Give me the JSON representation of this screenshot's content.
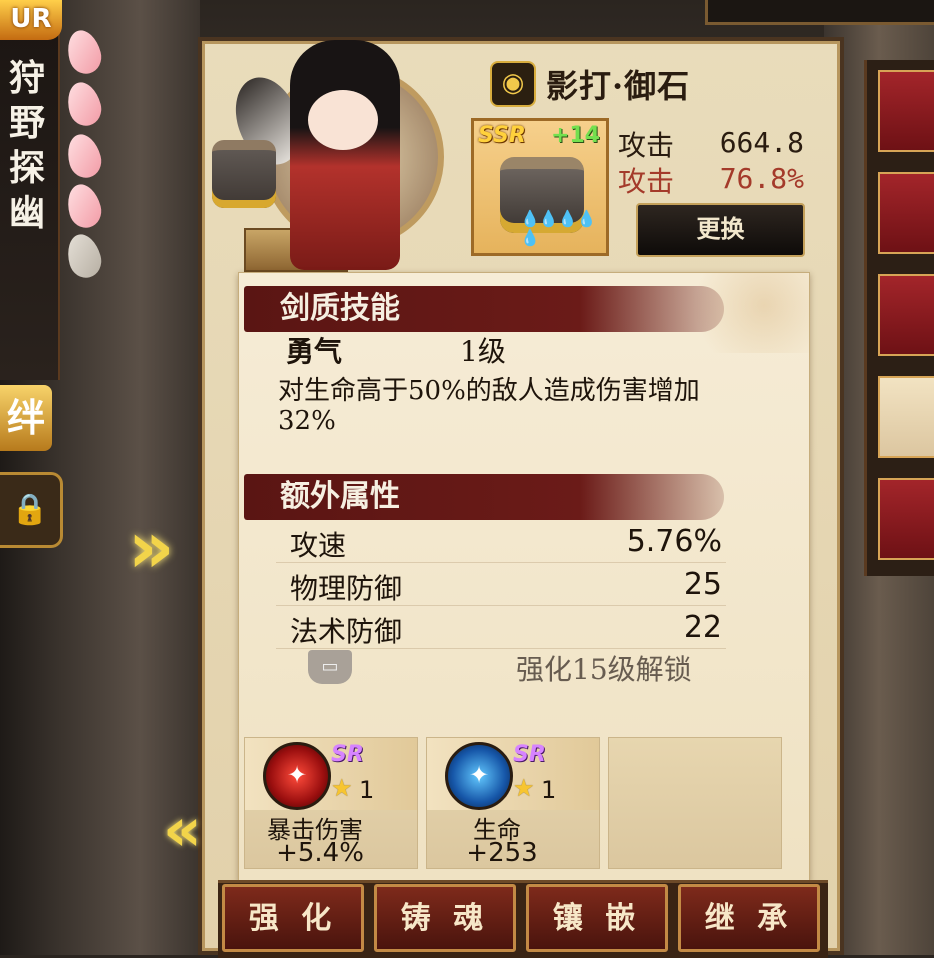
{
  "left_panel": {
    "rank_badge": "UR",
    "vertical_title": "狩野探幽",
    "kizuna_label": "绊"
  },
  "item": {
    "name": "影打·御石",
    "rarity": "SSR",
    "enhance_level": "+14",
    "flames": "💧💧💧💧💧"
  },
  "stats": [
    {
      "label": "攻击",
      "value": "664.8"
    },
    {
      "label": "攻击",
      "value": "76.8%"
    }
  ],
  "buttons": {
    "swap": "更换"
  },
  "skill": {
    "section_title": "剑质技能",
    "name": "勇气",
    "level": "1级",
    "description": "对生命高于50%的敌人造成伤害增加32%"
  },
  "extra_attrs": {
    "section_title": "额外属性",
    "rows": [
      {
        "name": "攻速",
        "value": "5.76%"
      },
      {
        "name": "物理防御",
        "value": "25"
      },
      {
        "name": "法术防御",
        "value": "22"
      }
    ],
    "locked_text": "强化15级解锁"
  },
  "soul_slots": [
    {
      "rarity": "SR",
      "stars": "1",
      "label": "暴击伤害",
      "value": "+5.4%"
    },
    {
      "rarity": "SR",
      "stars": "1",
      "label": "生命",
      "value": "+253"
    }
  ],
  "actions": [
    "强 化",
    "铸 魂",
    "镶 嵌",
    "继 承"
  ],
  "colors": {
    "accent_red": "#6b1b18",
    "gold": "#c38a45",
    "parchment": "#efe2c3"
  }
}
